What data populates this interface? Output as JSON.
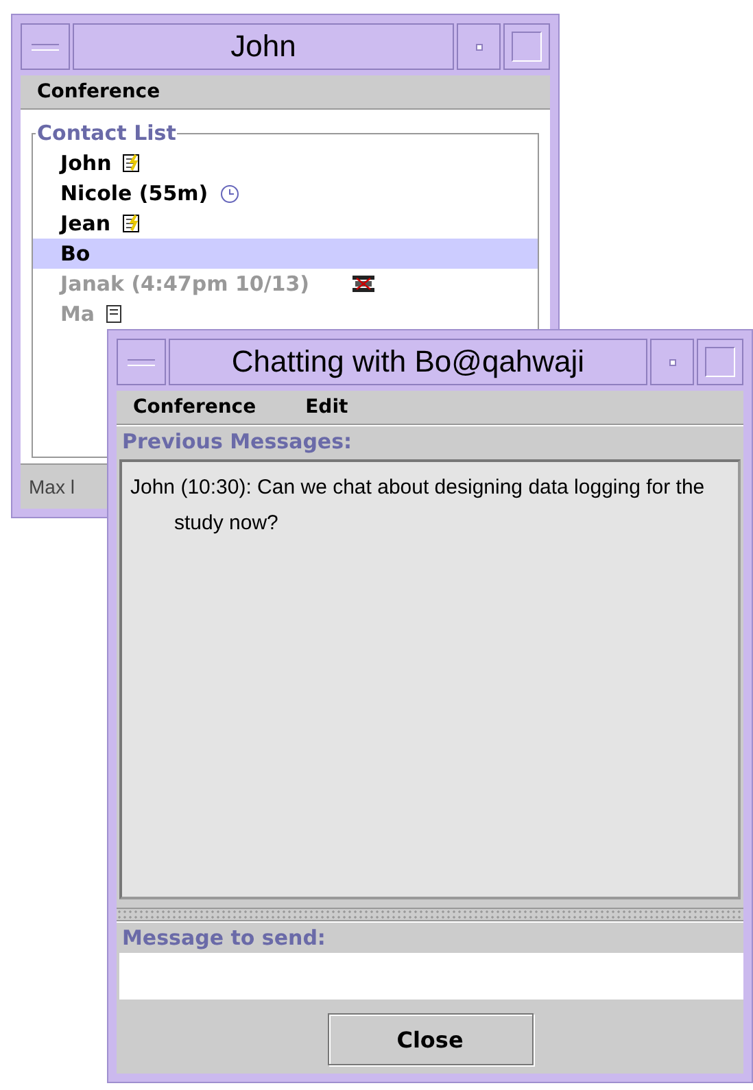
{
  "contact_window": {
    "title": "John",
    "menu": [
      "Conference"
    ],
    "group_title": "Contact List",
    "contacts": [
      {
        "name": "John",
        "kind": "note",
        "disabled": false,
        "selected": false
      },
      {
        "name": "Nicole (55m)",
        "kind": "clock",
        "disabled": false,
        "selected": false
      },
      {
        "name": "Jean",
        "kind": "note",
        "disabled": false,
        "selected": false
      },
      {
        "name": "Bo",
        "kind": "plain",
        "disabled": false,
        "selected": true
      },
      {
        "name": "Janak (4:47pm 10/13)",
        "kind": "pager",
        "disabled": true,
        "selected": false
      },
      {
        "name": "Ma",
        "kind": "document",
        "disabled": true,
        "selected": false
      }
    ],
    "status_bar": "Max l"
  },
  "chat_window": {
    "title": "Chatting with Bo@qahwaji",
    "menu": [
      "Conference",
      "Edit"
    ],
    "history_label": "Previous Messages:",
    "messages": [
      "John (10:30): Can we chat about designing data logging for the study now?"
    ],
    "compose_label": "Message to send:",
    "buttons": [
      "Close"
    ]
  }
}
